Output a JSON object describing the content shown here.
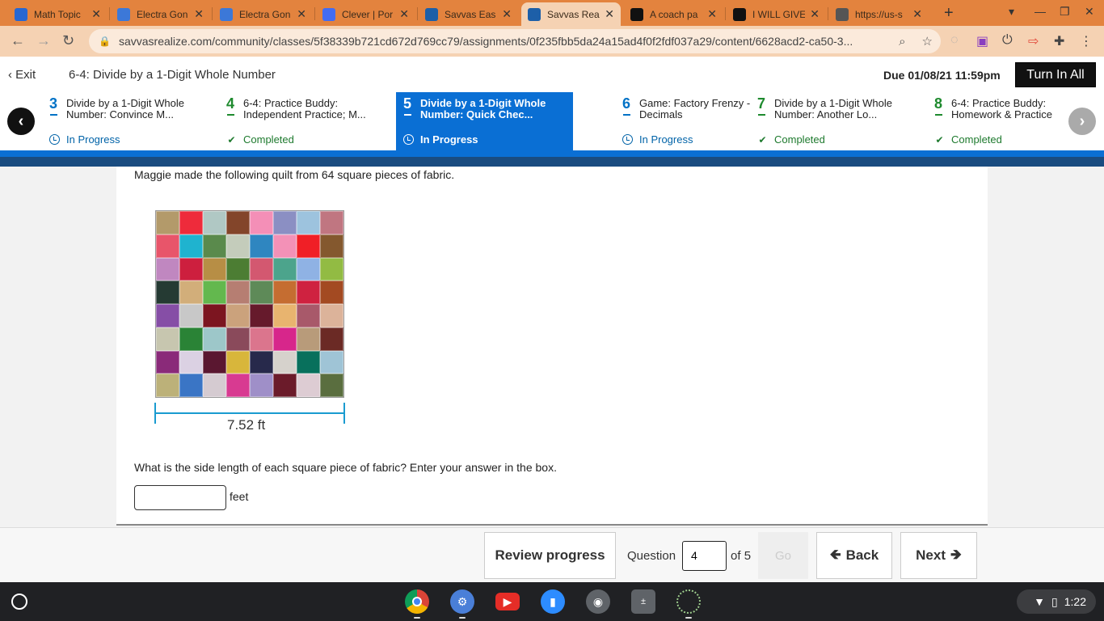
{
  "browser": {
    "tabs": [
      {
        "title": "Math Topic",
        "icon": "user-icon",
        "color": "#2767d2"
      },
      {
        "title": "Electra Gon",
        "icon": "docs-icon",
        "color": "#3c78d8"
      },
      {
        "title": "Electra Gon",
        "icon": "docs-icon",
        "color": "#3c78d8"
      },
      {
        "title": "Clever | Por",
        "icon": "clever-icon",
        "color": "#436cf2"
      },
      {
        "title": "Savvas Eas",
        "icon": "savvas-icon",
        "color": "#1d5fa8"
      },
      {
        "title": "Savvas Rea",
        "icon": "savvas-icon",
        "color": "#1d5fa8"
      },
      {
        "title": "A coach pa",
        "icon": "brainly-icon",
        "color": "#111111"
      },
      {
        "title": "I WILL GIVE",
        "icon": "brainly-icon",
        "color": "#111111"
      },
      {
        "title": "https://us-s",
        "icon": "globe-icon",
        "color": "#555555"
      }
    ],
    "active_tab_index": 5,
    "url": "savvasrealize.com/community/classes/5f38339b721cd672d769cc79/assignments/0f235fbb5da24a15ad4f0f2fdf037a29/content/6628acd2-ca50-3..."
  },
  "header": {
    "exit_label": "Exit",
    "assignment_title": "6-4: Divide by a 1-Digit Whole Number",
    "due": "Due 01/08/21 11:59pm",
    "turn_in_label": "Turn In All"
  },
  "lessons": [
    {
      "num": "3",
      "title": "Divide by a 1-Digit Whole Number: Convince M...",
      "status": "In Progress"
    },
    {
      "num": "4",
      "title": "6-4: Practice Buddy: Independent Practice; M...",
      "status": "Completed"
    },
    {
      "num": "5",
      "title": "Divide by a 1-Digit Whole Number: Quick Chec...",
      "status": "In Progress"
    },
    {
      "num": "6",
      "title": "Game: Factory Frenzy - Decimals",
      "status": "In Progress"
    },
    {
      "num": "7",
      "title": "Divide by a 1-Digit Whole Number: Another Lo...",
      "status": "Completed"
    },
    {
      "num": "8",
      "title": "6-4: Practice Buddy: Homework & Practice",
      "status": "Completed"
    }
  ],
  "question": {
    "intro": "Maggie made the following quilt from 64 square pieces of fabric.",
    "dimension_label": "7.52 ft",
    "prompt": "What is the side length of each square piece of fabric? Enter your answer in the box.",
    "answer_value": "",
    "unit": "feet"
  },
  "quilt_colors": [
    "#b39a6a",
    "#ee2b3b",
    "#b0c8c4",
    "#83452a",
    "#f48fb7",
    "#8b8fc3",
    "#9dc3de",
    "#c07681",
    "#e8556a",
    "#1fb3cf",
    "#5a8a4c",
    "#c4ccbb",
    "#2f86c0",
    "#f391b7",
    "#f01f26",
    "#84582e",
    "#c087c0",
    "#cd1f3e",
    "#b78e45",
    "#4c7d33",
    "#d35870",
    "#4ca48c",
    "#8fb2e4",
    "#92bb43",
    "#253a33",
    "#d2ae7a",
    "#63b84e",
    "#b67e72",
    "#5e8a58",
    "#c56d31",
    "#cf2240",
    "#a34a22",
    "#864ea6",
    "#c8c8c8",
    "#7c1520",
    "#cba27c",
    "#661a2c",
    "#e8b46f",
    "#a8596a",
    "#dcb39a",
    "#c7c6af",
    "#2a8336",
    "#9dc7c9",
    "#8a4a5b",
    "#db758d",
    "#d7268b",
    "#b89b7a",
    "#6b2a25",
    "#8a2a79",
    "#dbd1e3",
    "#5a1730",
    "#d8b63b",
    "#27294b",
    "#d6d2cc",
    "#08705c",
    "#9fc4d6",
    "#bcb179",
    "#3a75c5",
    "#d5cbd1",
    "#d83a91",
    "#9f8fc8",
    "#6b1b2a",
    "#ddccd3",
    "#5a6e3f"
  ],
  "footer": {
    "review_label": "Review progress",
    "question_label": "Question",
    "question_value": "4",
    "of_label": "of 5",
    "go_label": "Go",
    "back_label": "Back",
    "next_label": "Next"
  },
  "shelf": {
    "time": "1:22"
  }
}
